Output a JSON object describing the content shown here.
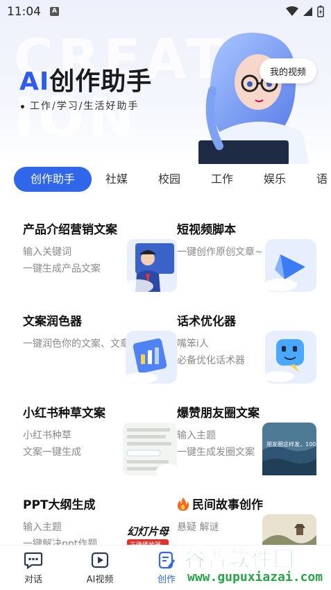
{
  "status_bar": {
    "time": "11:04",
    "notif_icon_letter": "A"
  },
  "hero": {
    "title_ai": "AI",
    "title_rest": "创作助手",
    "subtitle": "工作/学习/生活好助手",
    "my_video_button": "我的视频",
    "watermark_text": "CREAT ION"
  },
  "tabs": [
    {
      "label": "创作助手",
      "active": true
    },
    {
      "label": "社媒"
    },
    {
      "label": "校园"
    },
    {
      "label": "工作"
    },
    {
      "label": "娱乐"
    },
    {
      "label": "语"
    }
  ],
  "cards": [
    {
      "title": "产品介绍营销文案",
      "desc1": "输入关键词",
      "desc2": "一键生成产品文案",
      "thumb": "businessman-illustration"
    },
    {
      "title": "短视频脚本",
      "desc1": "一键创作原创文章~",
      "desc2": "",
      "thumb": "play-arrow-3d"
    },
    {
      "title": "文案润色器",
      "desc1": "一键润色你的文案、文章",
      "desc2": "",
      "thumb": "document-chart-3d"
    },
    {
      "title": "话术优化器",
      "desc1": "嘴笨i人",
      "desc2": "必备优化话术器",
      "thumb": "chat-bot-3d"
    },
    {
      "title": "小红书种草文案",
      "desc1": "小红书种草",
      "desc2": "文案一键生成",
      "thumb": "notes-screenshot"
    },
    {
      "title": "爆赞朋友圈文案",
      "desc1": "输入主题",
      "desc2": "一键生成发圈文案",
      "thumb": "sea-photo",
      "thumb_caption": "朋友圈这样发，100"
    },
    {
      "title": "PPT大纲生成",
      "desc1": "输入主题",
      "desc2": "一键解决ppt作题",
      "thumb": "slides-poster",
      "thumb_caption1": "幻灯片母",
      "thumb_caption2": "正确播放器"
    },
    {
      "title": "民间故事创作",
      "desc1": "悬疑 解谜",
      "desc2": "",
      "thumb": "landscape-painting",
      "title_icon": "fire-icon"
    }
  ],
  "bottom_nav": [
    {
      "label": "对话",
      "icon": "chat-bubble-icon"
    },
    {
      "label": "AI视频",
      "icon": "video-play-icon"
    },
    {
      "label": "创作",
      "icon": "edit-doc-icon",
      "active": true
    }
  ],
  "watermark": {
    "brand": "谷普软件园",
    "url": "www.gupuxiazai.com"
  },
  "colors": {
    "accent": "#2f66ea",
    "title_ai": "#2f5bea",
    "watermark_green": "#2aa34a"
  }
}
